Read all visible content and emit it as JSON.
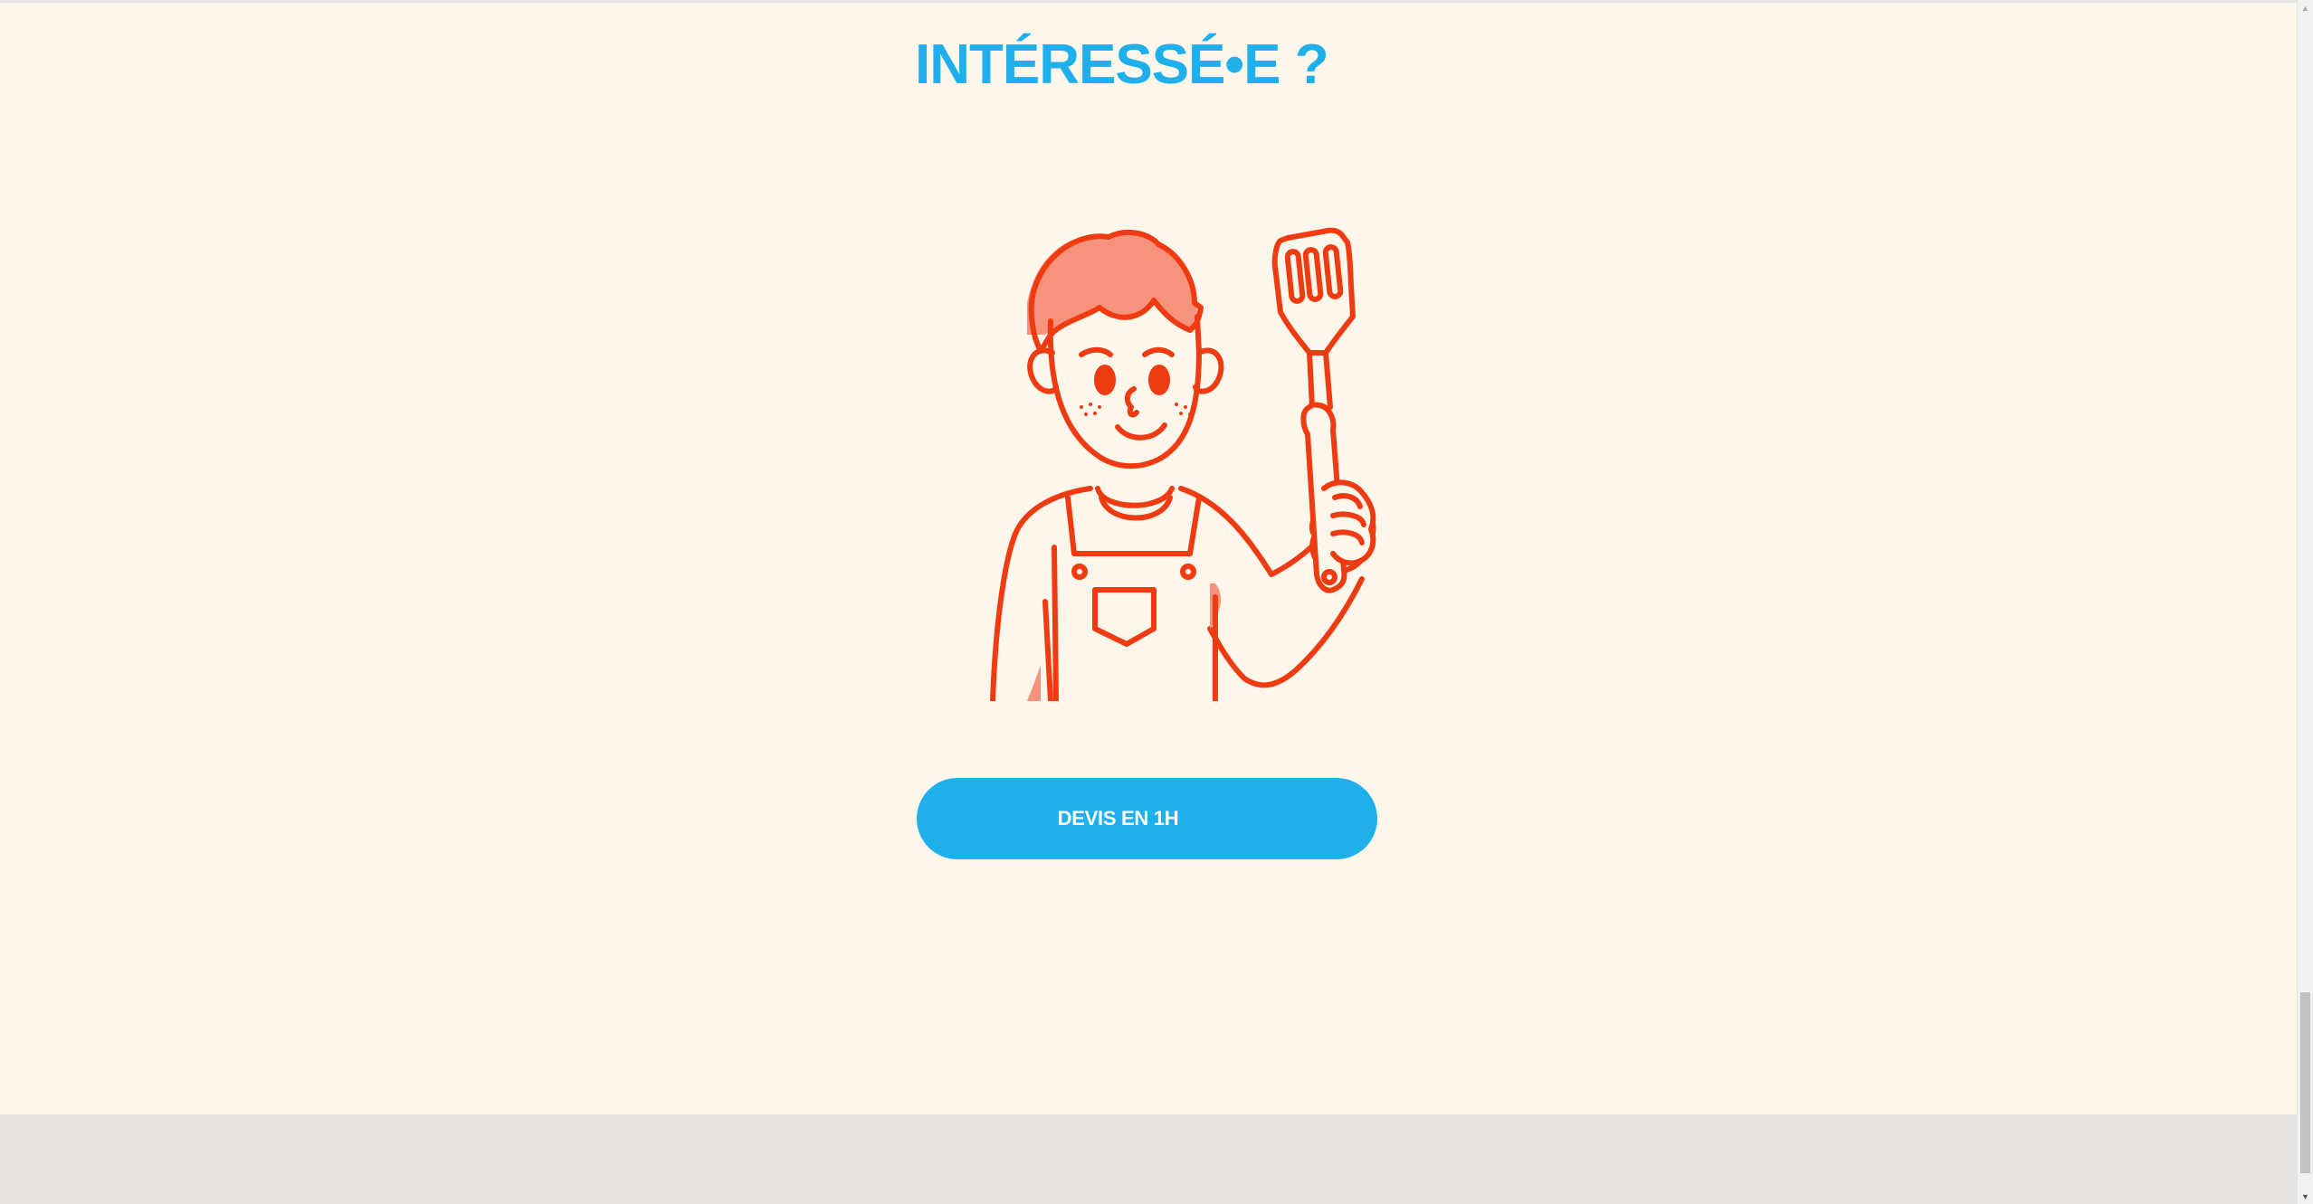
{
  "page": {
    "heading": "INTÉRESSÉ•E ?",
    "cta_label": "DEVIS EN 1H"
  },
  "illustration": {
    "subject": "chef-with-spatula-illustration"
  },
  "colors": {
    "background": "#fcf6eb",
    "accent_blue": "#1fb0ec",
    "illustration_stroke": "#ef3b12",
    "illustration_fill": "#f7927c",
    "footer_band": "#e8e3de"
  },
  "scrollbar": {
    "up_icon": "triangle-up-icon",
    "down_icon": "triangle-down-icon"
  }
}
